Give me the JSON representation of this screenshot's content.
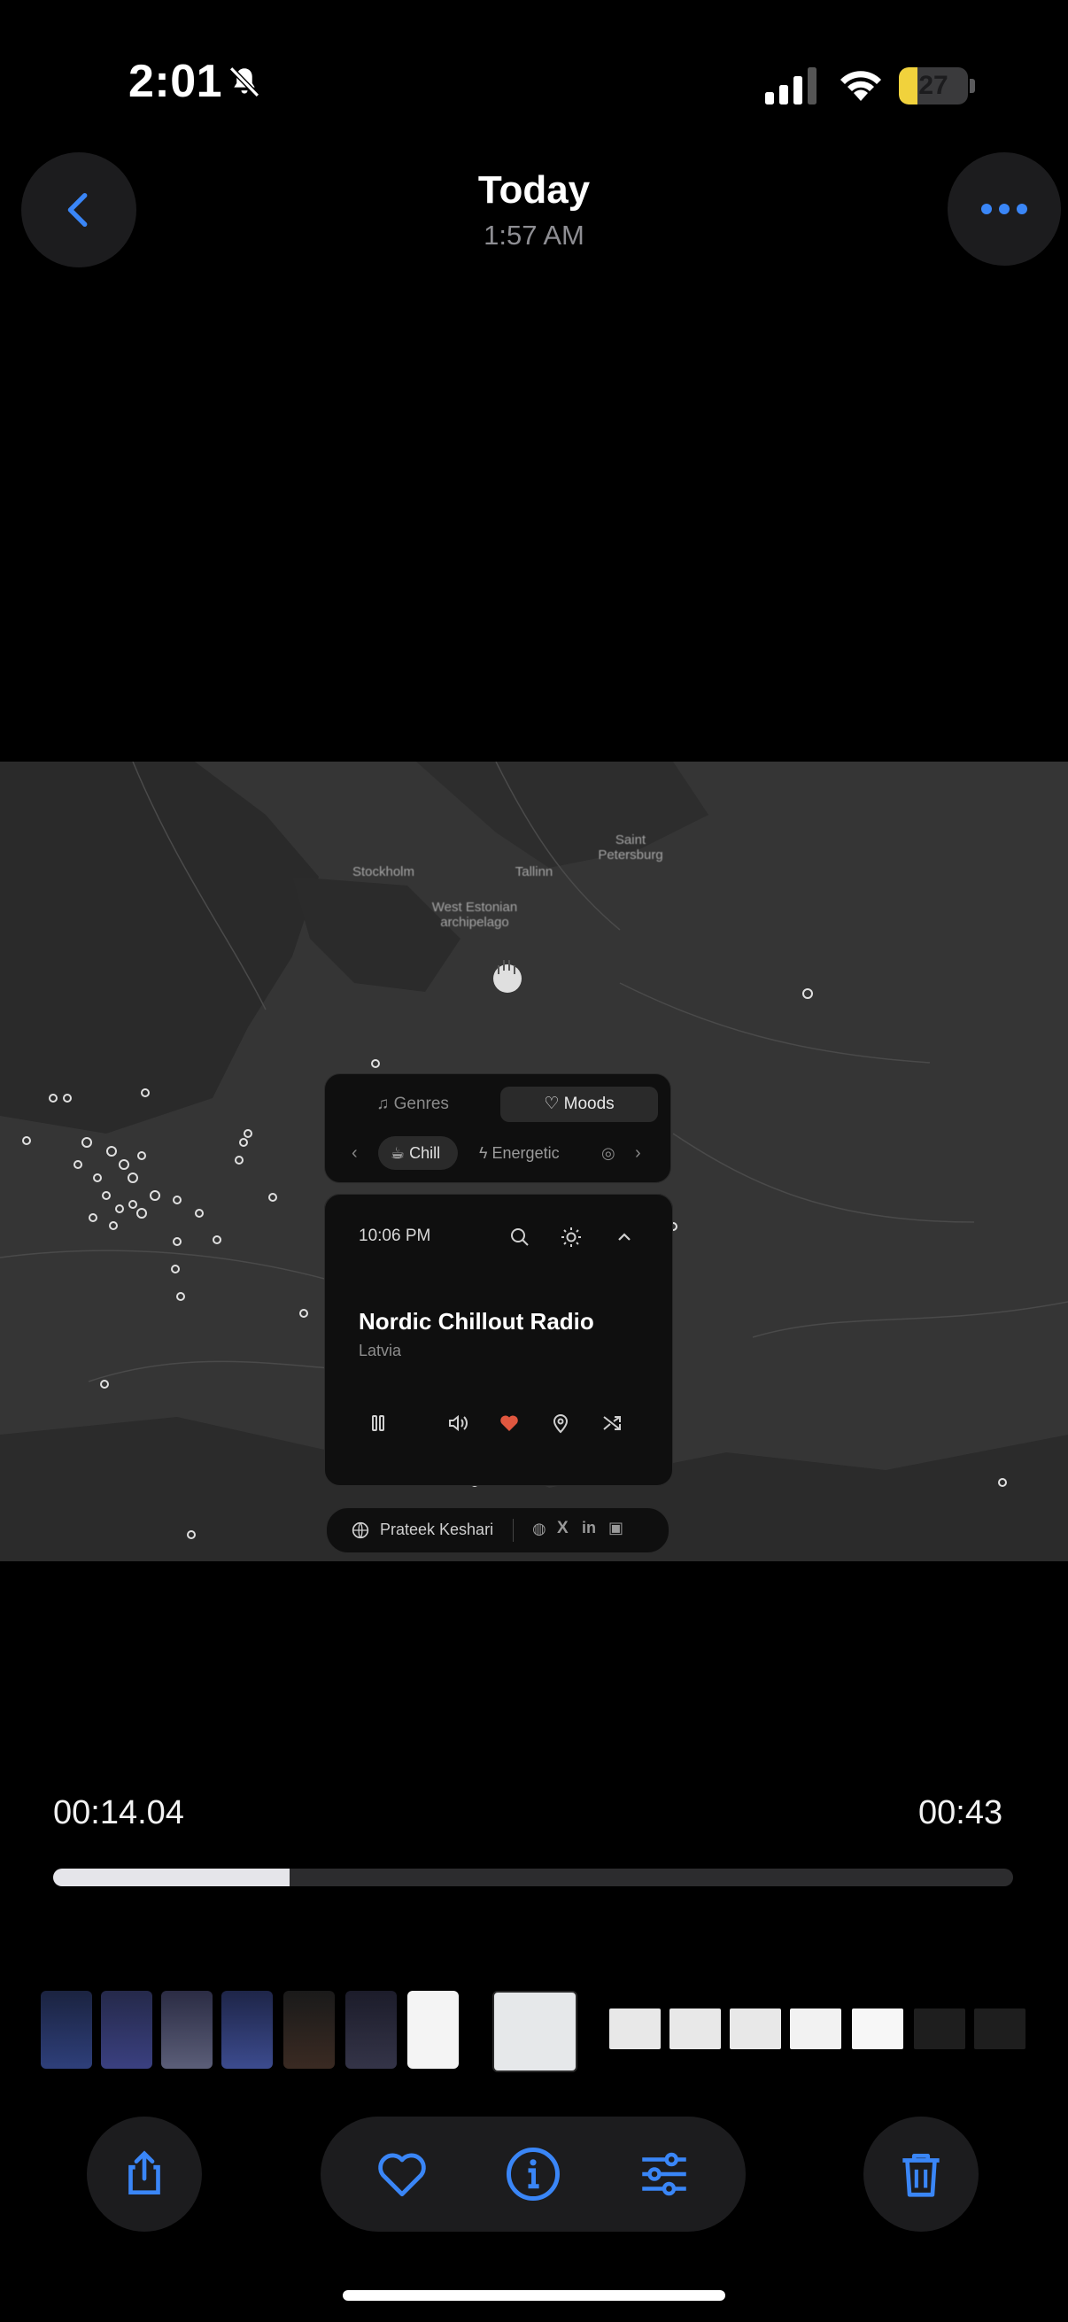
{
  "status_bar": {
    "time": "2:01",
    "battery_level": "27",
    "battery_fraction": 0.27,
    "icons": [
      "bell-slash-icon",
      "cellular-signal-icon",
      "wifi-icon",
      "battery-icon"
    ]
  },
  "nav": {
    "title": "Today",
    "subtitle": "1:57 AM",
    "back_icon": "chevron-left-icon",
    "more_icon": "ellipsis-icon",
    "accent_color": "#3a86f7"
  },
  "video_frame": {
    "map_labels": [
      "Saint Petersburg",
      "Stockholm",
      "Tallinn",
      "West Estonian archipelago"
    ],
    "tabs": [
      {
        "label": "Genres",
        "icon": "music-note-icon",
        "selected": false
      },
      {
        "label": "Moods",
        "icon": "heart-outline-icon",
        "selected": true
      }
    ],
    "chips": [
      {
        "label": "Chill",
        "icon": "cup-icon",
        "selected": true
      },
      {
        "label": "Energetic",
        "icon": "bolt-icon",
        "selected": false
      }
    ],
    "player": {
      "time": "10:06 PM",
      "station": "Nordic Chillout Radio",
      "country": "Latvia",
      "favorite_color": "#e0573f"
    },
    "credit": {
      "name": "Prateek Keshari"
    }
  },
  "playback": {
    "elapsed": "00:14.04",
    "duration": "00:43",
    "progress": 0.2463
  },
  "toolbar": {
    "share_icon": "share-icon",
    "favorite_icon": "heart-icon",
    "info_icon": "info-icon",
    "adjust_icon": "sliders-icon",
    "delete_icon": "trash-icon"
  }
}
